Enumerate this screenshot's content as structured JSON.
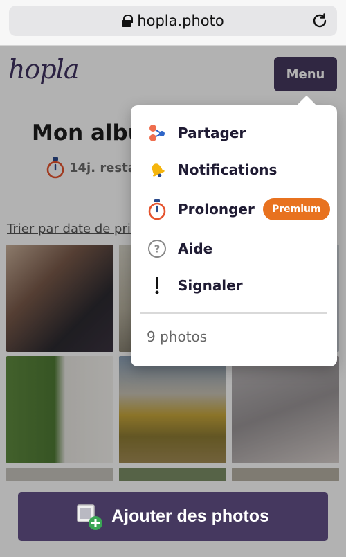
{
  "browser": {
    "url": "hopla.photo",
    "lock_icon": "lock-icon",
    "reload_icon": "reload-icon"
  },
  "header": {
    "logo": "hopla",
    "menu_label": "Menu"
  },
  "album": {
    "title": "Mon album",
    "remaining": "14j. restants",
    "timer_icon": "timer-icon",
    "sort_label": "Trier par date de prise de vue"
  },
  "menu": {
    "items": [
      {
        "label": "Partager",
        "icon": "share-icon"
      },
      {
        "label": "Notifications",
        "icon": "bell-icon"
      },
      {
        "label": "Prolonger",
        "icon": "timer-icon",
        "badge": "Premium"
      },
      {
        "label": "Aide",
        "icon": "help-icon"
      },
      {
        "label": "Signaler",
        "icon": "exclamation-icon"
      }
    ],
    "count": "9 photos"
  },
  "footer": {
    "add_label": "Ajouter des photos",
    "add_icon": "add-photo-icon"
  },
  "colors": {
    "brand": "#45385f",
    "premium": "#e8721f",
    "accent_green": "#3aa655"
  }
}
